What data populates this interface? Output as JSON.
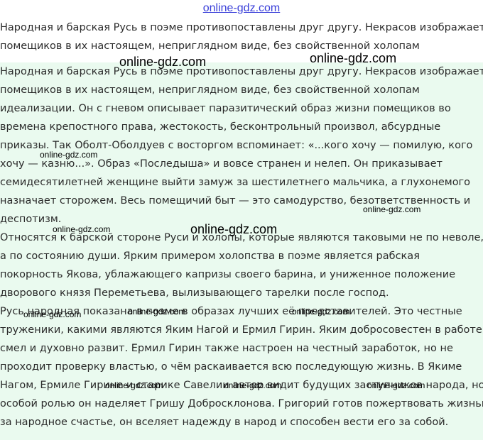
{
  "header": {
    "site_link": "online-gdz.com"
  },
  "preview": {
    "lines": [
      "Народная и барская Русь в поэме противопоставлены друг другу. Некрасов изображает",
      "помещиков в их настоящем, неприглядном виде, без свойственной холопам"
    ]
  },
  "essay": {
    "lines": [
      "Народная и барская Русь в поэме противопоставлены друг другу. Некрасов изображает",
      "помещиков в их настоящем, неприглядном виде, без свойственной холопам",
      "идеализации. Он с гневом описывает паразитический образ жизни помещиков во",
      "времена крепостного права, жестокость, бесконтрольный произвол, абсурдные",
      "приказы. Так Оболт-Оболдуев с восторгом вспоминает: «...кого хочу — помилую, кого",
      "хочу — казню...». Образ «Последыша» и вовсе странен и нелеп. Он приказывает",
      "семидесятилетней женщине выйти замуж за шестилетнего мальчика, а глухонемого",
      "назначает сторожем. Весь помещичий быт — это самодурство, безответственность и",
      "деспотизм.",
      "Относятся к барской стороне Руси и холопы, которые являются таковыми не по неволе,",
      "а по состоянию души. Ярким примером холопства в поэме является рабская",
      "покорность Якова, ублажающего капризы своего барина, и униженное положение",
      "дворового князя Переметьева, вылизывающего тарелки после господ.",
      "Русь народная показана в поэме в образах лучших её представителей. Это честные",
      "труженики, какими являются Яким Нагой и Ермил Гирин. Яким добросовестен в работе,",
      "смел и духовно развит. Ермил Гирин также настроен на честный заработок, но не",
      "проходит проверку властью, о чём раскаивается всю последующую жизнь. В Якиме",
      "Нагом, Ермиле Гирине и старике Савелии автор видит будущих заступников народа, но",
      "особой ролью он наделяет Гришу Добросклонова. Григорий готов пожертвовать жизнью",
      "за народное счастье, он вселяет надежду в народ и способен вести его за собой."
    ]
  },
  "watermarks": {
    "big": "online-gdz.com",
    "small": "online-gdz.com"
  }
}
